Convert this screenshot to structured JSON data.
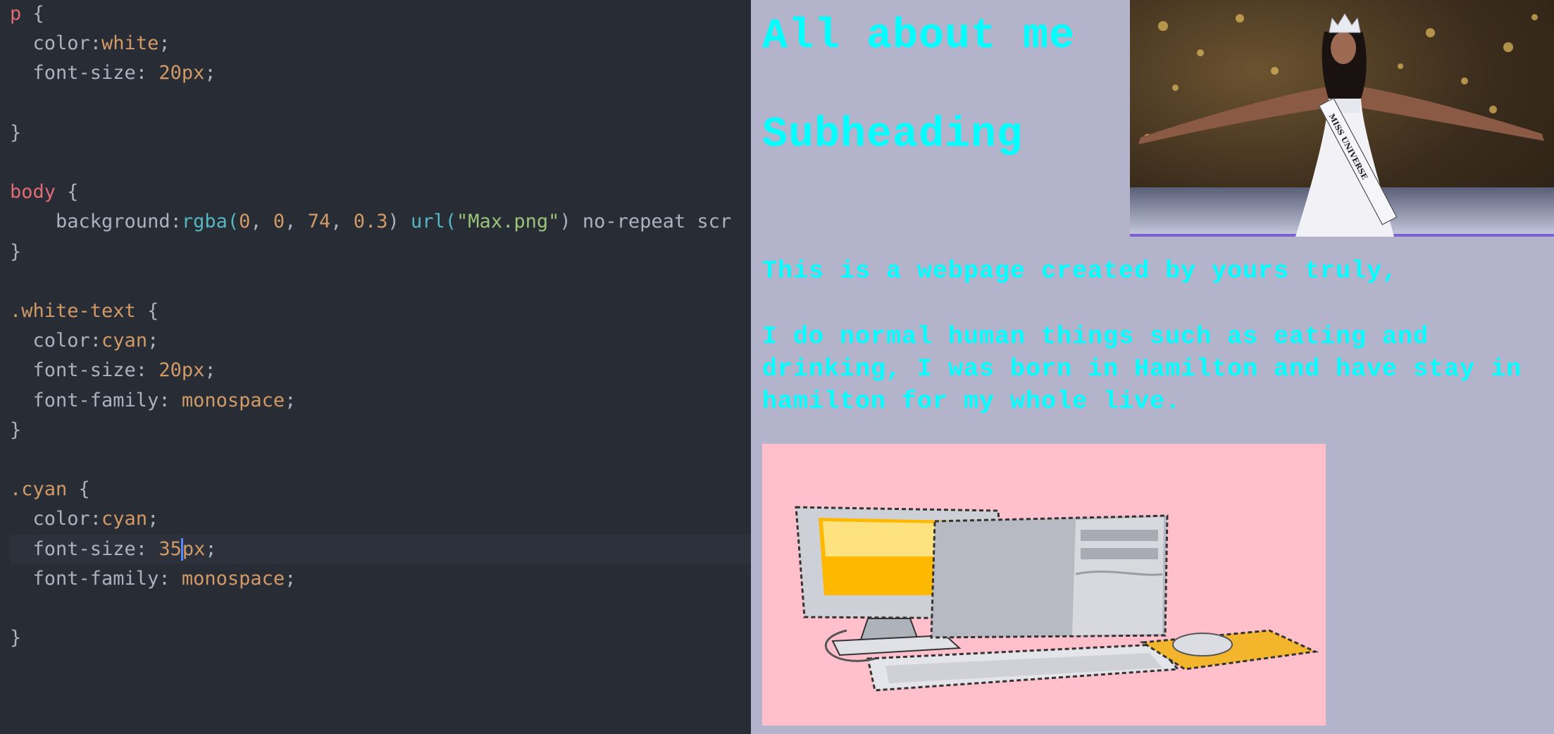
{
  "editor": {
    "lines": [
      {
        "row": 0,
        "parts": [
          {
            "c": "t-tag",
            "t": "p"
          },
          {
            "c": "t-punc",
            "t": " {"
          }
        ]
      },
      {
        "row": 1,
        "parts": [
          {
            "c": "t-prop",
            "t": "  color:"
          },
          {
            "c": "t-val",
            "t": "white"
          },
          {
            "c": "t-punc",
            "t": ";"
          }
        ]
      },
      {
        "row": 2,
        "parts": [
          {
            "c": "t-prop",
            "t": "  font-size: "
          },
          {
            "c": "t-num",
            "t": "20px"
          },
          {
            "c": "t-punc",
            "t": ";"
          }
        ]
      },
      {
        "row": 4,
        "parts": [
          {
            "c": "t-punc",
            "t": "}"
          }
        ]
      },
      {
        "row": 6,
        "parts": [
          {
            "c": "t-tag",
            "t": "body"
          },
          {
            "c": "t-punc",
            "t": " {"
          }
        ]
      },
      {
        "row": 7,
        "parts": [
          {
            "c": "t-prop",
            "t": "    background:"
          },
          {
            "c": "t-fn",
            "t": "rgba("
          },
          {
            "c": "t-num",
            "t": "0"
          },
          {
            "c": "t-punc",
            "t": ", "
          },
          {
            "c": "t-num",
            "t": "0"
          },
          {
            "c": "t-punc",
            "t": ", "
          },
          {
            "c": "t-num",
            "t": "74"
          },
          {
            "c": "t-punc",
            "t": ", "
          },
          {
            "c": "t-num",
            "t": "0.3"
          },
          {
            "c": "t-punc",
            "t": ") "
          },
          {
            "c": "t-fn",
            "t": "url("
          },
          {
            "c": "t-str",
            "t": "\"Max.png\""
          },
          {
            "c": "t-punc",
            "t": ") no-repeat scr"
          }
        ]
      },
      {
        "row": 8,
        "parts": [
          {
            "c": "t-punc",
            "t": "}"
          }
        ]
      },
      {
        "row": 10,
        "parts": [
          {
            "c": "t-cls",
            "t": ".white-text"
          },
          {
            "c": "t-punc",
            "t": " {"
          }
        ]
      },
      {
        "row": 11,
        "parts": [
          {
            "c": "t-prop",
            "t": "  color:"
          },
          {
            "c": "t-val",
            "t": "cyan"
          },
          {
            "c": "t-punc",
            "t": ";"
          }
        ]
      },
      {
        "row": 12,
        "parts": [
          {
            "c": "t-prop",
            "t": "  font-size: "
          },
          {
            "c": "t-num",
            "t": "20px"
          },
          {
            "c": "t-punc",
            "t": ";"
          }
        ]
      },
      {
        "row": 13,
        "parts": [
          {
            "c": "t-prop",
            "t": "  font-family: "
          },
          {
            "c": "t-val",
            "t": "monospace"
          },
          {
            "c": "t-punc",
            "t": ";"
          }
        ]
      },
      {
        "row": 14,
        "parts": [
          {
            "c": "t-punc",
            "t": "}"
          }
        ]
      },
      {
        "row": 16,
        "parts": [
          {
            "c": "t-cls",
            "t": ".cyan"
          },
          {
            "c": "t-punc",
            "t": " {"
          }
        ]
      },
      {
        "row": 17,
        "parts": [
          {
            "c": "t-prop",
            "t": "  color:"
          },
          {
            "c": "t-val",
            "t": "cyan"
          },
          {
            "c": "t-punc",
            "t": ";"
          }
        ]
      },
      {
        "row": 18,
        "highlight": true,
        "parts": [
          {
            "c": "t-prop",
            "t": "  font-size: "
          },
          {
            "c": "t-num",
            "t": "35"
          },
          {
            "c": "caret",
            "t": ""
          },
          {
            "c": "t-num",
            "t": "px"
          },
          {
            "c": "t-punc",
            "t": ";"
          }
        ]
      },
      {
        "row": 19,
        "parts": [
          {
            "c": "t-prop",
            "t": "  font-family: "
          },
          {
            "c": "t-val",
            "t": "monospace"
          },
          {
            "c": "t-punc",
            "t": ";"
          }
        ]
      },
      {
        "row": 21,
        "parts": [
          {
            "c": "t-punc",
            "t": "}"
          }
        ]
      }
    ]
  },
  "preview": {
    "heading": "All about me",
    "subheading": "Subheading",
    "intro": "This is a webpage created by yours truly,",
    "bio": "I do normal human things such as eating and drinking, I was born in Hamilton and have stay in hamilton for my whole live.",
    "photo": {
      "sash_text": "MISS UNIVERSE"
    },
    "colors": {
      "text": "#00ffff",
      "background": "#b3b3cc",
      "image_bg": "#ffc0cb"
    }
  }
}
